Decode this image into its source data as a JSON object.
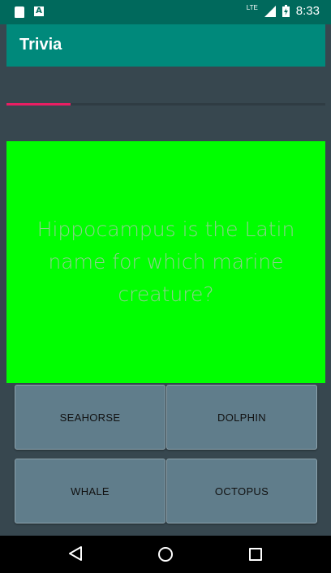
{
  "status_bar": {
    "time": "8:33",
    "network_label": "LTE",
    "icons": [
      "sd-card-icon",
      "a-notification-icon",
      "signal-icon",
      "battery-charging-icon"
    ]
  },
  "app_bar": {
    "title": "Trivia"
  },
  "progress": {
    "fraction": 0.2,
    "color": "#e91e63"
  },
  "question": {
    "text": "Hippocampus is the Latin name for which marine creature?",
    "background": "#00ff00"
  },
  "answers": [
    {
      "label": "SEAHORSE"
    },
    {
      "label": "DOLPHIN"
    },
    {
      "label": "WHALE"
    },
    {
      "label": "OCTOPUS"
    }
  ],
  "nav_bar": {
    "icons": [
      "back-icon",
      "home-icon",
      "recent-apps-icon"
    ]
  },
  "colors": {
    "primary": "#00897b",
    "primary_dark": "#00695c",
    "accent": "#e91e63",
    "background": "#37474f",
    "button": "#607d8b"
  }
}
